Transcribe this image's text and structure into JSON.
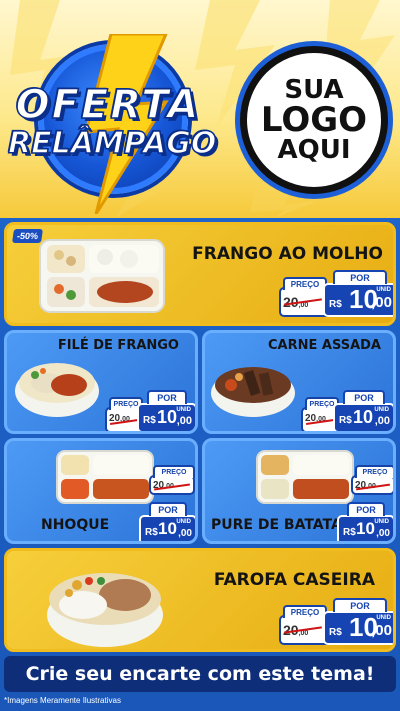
{
  "header": {
    "badge_line1": "OFERTA",
    "badge_line2": "RELÂMPAGO",
    "logo_line1": "SUA",
    "logo_line2": "LOGO",
    "logo_line3": "AQUI"
  },
  "price_labels": {
    "old_label": "PREÇO",
    "new_label": "POR",
    "currency": "R$",
    "unit": "UNID"
  },
  "products": [
    {
      "name": "FRANGO AO MOLHO",
      "discount": "-50%",
      "old_price_int": "20",
      "old_price_cents": ",00",
      "price_int": "10",
      "price_cents": ",00"
    },
    {
      "name": "FILÉ DE FRANGO",
      "old_price_int": "20",
      "old_price_cents": ",00",
      "price_int": "10",
      "price_cents": ",00"
    },
    {
      "name": "CARNE ASSADA",
      "old_price_int": "20",
      "old_price_cents": ",00",
      "price_int": "10",
      "price_cents": ",00"
    },
    {
      "name": "NHOQUE",
      "old_price_int": "20",
      "old_price_cents": ",00",
      "price_int": "10",
      "price_cents": ",00"
    },
    {
      "name": "PURE DE BATATA",
      "old_price_int": "20",
      "old_price_cents": ",00",
      "price_int": "10",
      "price_cents": ",00"
    },
    {
      "name": "FAROFA CASEIRA",
      "old_price_int": "20",
      "old_price_cents": ",00",
      "price_int": "10",
      "price_cents": ",00"
    }
  ],
  "cta_text": "Crie seu encarte com este tema!",
  "disclaimer": "*Imagens Meramente Ilustrativas",
  "colors": {
    "gold": "#f1bd1e",
    "blue": "#1e63c9",
    "dark_blue": "#1644b3"
  }
}
